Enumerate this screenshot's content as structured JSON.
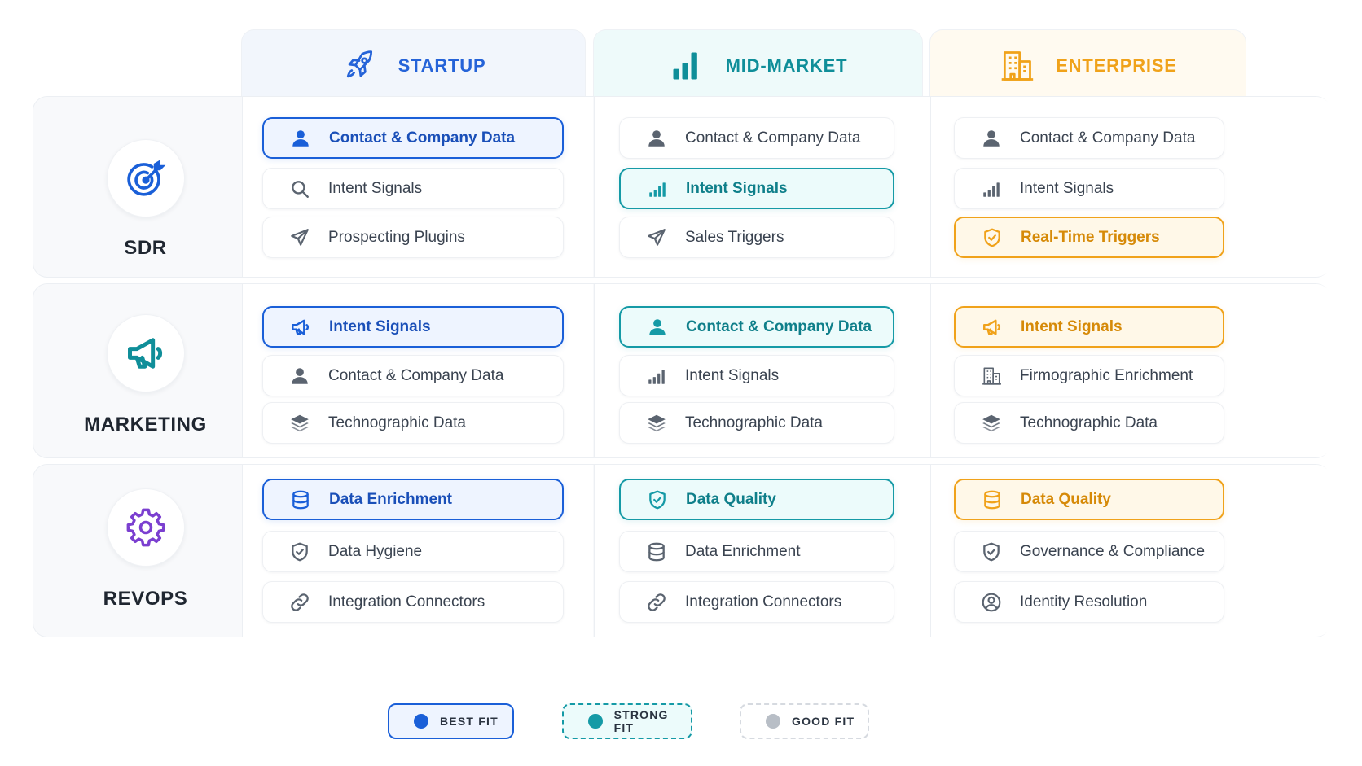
{
  "columns": [
    {
      "key": "startup",
      "title": "STARTUP",
      "icon": "rocket-icon",
      "color": "#2563d8",
      "bg": "#f2f6fc"
    },
    {
      "key": "midmarket",
      "title": "MID-MARKET",
      "icon": "bar-chart-icon",
      "color": "#0f8e99",
      "bg": "#eefafa"
    },
    {
      "key": "enterprise",
      "title": "ENTERPRISE",
      "icon": "building-icon",
      "color": "#f0a21a",
      "bg": "#fffaf0"
    }
  ],
  "rows": [
    {
      "title": "SDR",
      "icon": "target-icon",
      "icon_color": "#1a5fd8",
      "cells": [
        [
          {
            "label": "Contact & Company Data",
            "icon": "person-icon",
            "fit": "best"
          },
          {
            "label": "Intent Signals",
            "icon": "search-icon",
            "fit": "none"
          },
          {
            "label": "Prospecting Plugins",
            "icon": "send-icon",
            "fit": "none"
          }
        ],
        [
          {
            "label": "Contact & Company Data",
            "icon": "person-icon",
            "fit": "none"
          },
          {
            "label": "Intent Signals",
            "icon": "signal-icon",
            "fit": "strong"
          },
          {
            "label": "Sales Triggers",
            "icon": "send-icon",
            "fit": "none"
          }
        ],
        [
          {
            "label": "Contact & Company Data",
            "icon": "person-icon",
            "fit": "none"
          },
          {
            "label": "Intent Signals",
            "icon": "signal-icon",
            "fit": "none"
          },
          {
            "label": "Real-Time Triggers",
            "icon": "shield-icon",
            "fit": "ent"
          }
        ]
      ]
    },
    {
      "title": "MARKETING",
      "icon": "megaphone-icon",
      "icon_color": "#0f8e99",
      "cells": [
        [
          {
            "label": "Intent Signals",
            "icon": "megaphone-icon",
            "fit": "best"
          },
          {
            "label": "Contact & Company Data",
            "icon": "person-icon",
            "fit": "none"
          },
          {
            "label": "Technographic Data",
            "icon": "layers-icon",
            "fit": "none"
          }
        ],
        [
          {
            "label": "Contact & Company Data",
            "icon": "person-icon",
            "fit": "strong"
          },
          {
            "label": "Intent Signals",
            "icon": "signal-icon",
            "fit": "none"
          },
          {
            "label": "Technographic Data",
            "icon": "layers-icon",
            "fit": "none"
          }
        ],
        [
          {
            "label": "Intent Signals",
            "icon": "megaphone-icon",
            "fit": "ent"
          },
          {
            "label": "Firmographic Enrichment",
            "icon": "building-icon",
            "fit": "none"
          },
          {
            "label": "Technographic Data",
            "icon": "layers-icon",
            "fit": "none"
          }
        ]
      ]
    },
    {
      "title": "REVOPS",
      "icon": "gear-icon",
      "icon_color": "#7b3fd0",
      "cells": [
        [
          {
            "label": "Data Enrichment",
            "icon": "database-icon",
            "fit": "best"
          },
          {
            "label": "Data Hygiene",
            "icon": "shield-icon",
            "fit": "none"
          },
          {
            "label": "Integration Connectors",
            "icon": "link-icon",
            "fit": "none"
          }
        ],
        [
          {
            "label": "Data Quality",
            "icon": "shield-icon",
            "fit": "strong"
          },
          {
            "label": "Data Enrichment",
            "icon": "database-icon",
            "fit": "none"
          },
          {
            "label": "Integration Connectors",
            "icon": "link-icon",
            "fit": "none"
          }
        ],
        [
          {
            "label": "Data Quality",
            "icon": "database-icon",
            "fit": "ent"
          },
          {
            "label": "Governance & Compliance",
            "icon": "shield-icon",
            "fit": "none"
          },
          {
            "label": "Identity Resolution",
            "icon": "user-circle-icon",
            "fit": "none"
          }
        ]
      ]
    }
  ],
  "legend": [
    {
      "label": "BEST FIT",
      "dot_color": "#1a5fd8",
      "border_color": "#1a5fd8",
      "bg": "#eef4ff",
      "style": "solid"
    },
    {
      "label": "STRONG FIT",
      "dot_color": "#159aa6",
      "border_color": "#159aa6",
      "bg": "#ecfbfb",
      "style": "dashed"
    },
    {
      "label": "GOOD FIT",
      "dot_color": "#b8bec6",
      "border_color": "#d6dae0",
      "bg": "#ffffff",
      "style": "dashed"
    }
  ]
}
